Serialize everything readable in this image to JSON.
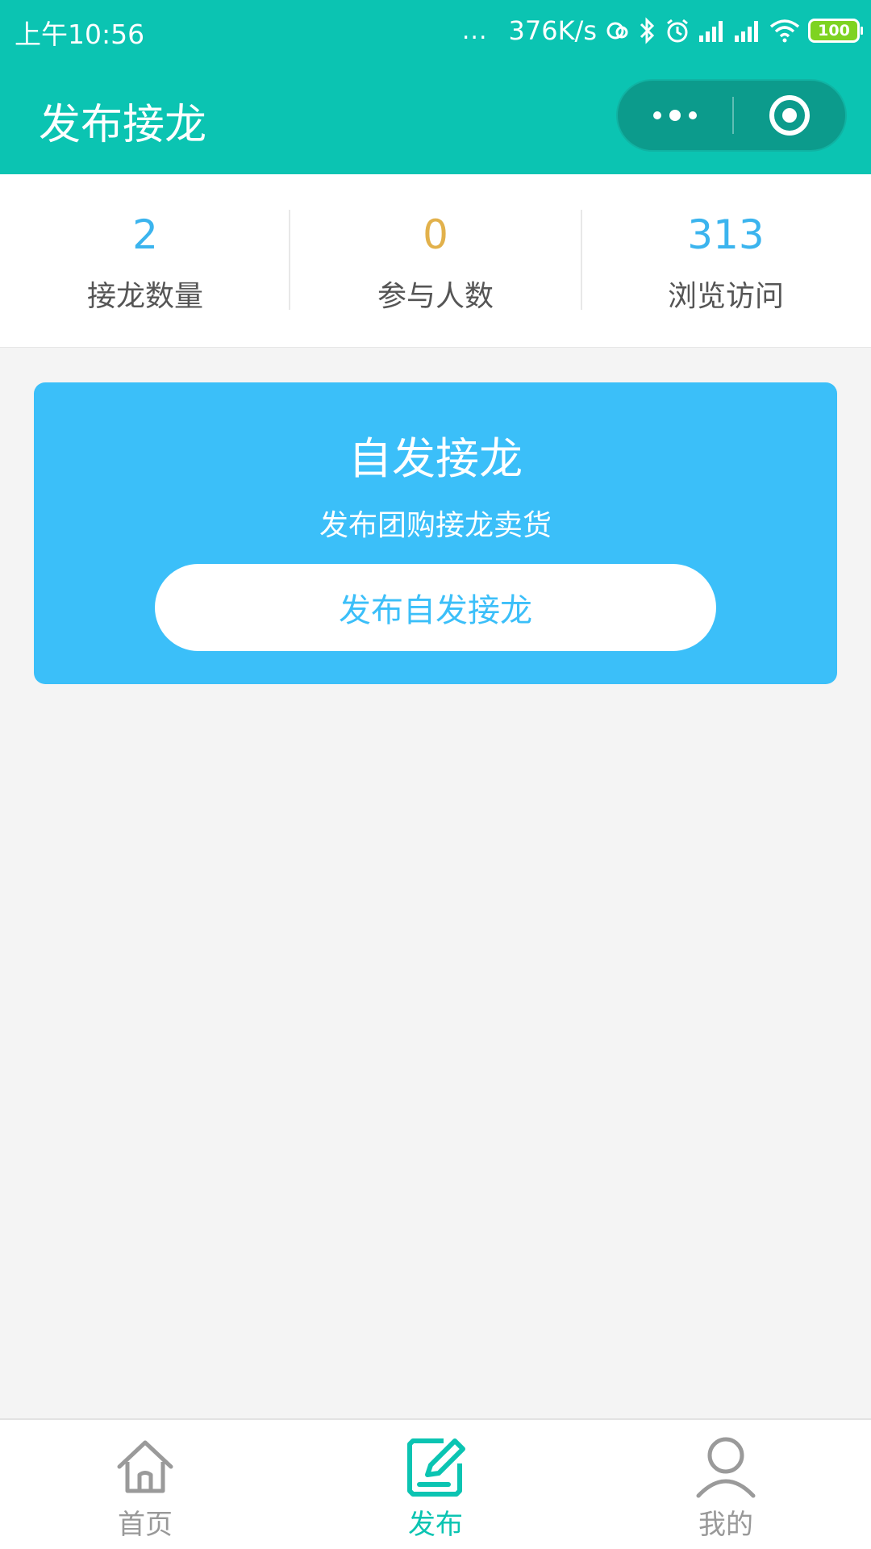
{
  "status_bar": {
    "time": "上午10:56",
    "dots": "...",
    "speed": "376K/s",
    "battery": "100",
    "icons": [
      "sync-icon",
      "bluetooth-icon",
      "alarm-icon",
      "signal-icon",
      "signal-icon",
      "wifi-icon",
      "battery-icon"
    ]
  },
  "nav": {
    "title": "发布接龙",
    "more_icon": "more-icon",
    "close_icon": "target-icon"
  },
  "stats": [
    {
      "value": "2",
      "label": "接龙数量",
      "color": "#3bb4ee"
    },
    {
      "value": "0",
      "label": "参与人数",
      "color": "#e2b14b"
    },
    {
      "value": "313",
      "label": "浏览访问",
      "color": "#3bb4ee"
    }
  ],
  "card": {
    "title": "自发接龙",
    "subtitle": "发布团购接龙卖货",
    "button_label": "发布自发接龙"
  },
  "tabbar": {
    "items": [
      {
        "label": "首页",
        "icon": "home-icon",
        "active": false
      },
      {
        "label": "发布",
        "icon": "edit-icon",
        "active": true
      },
      {
        "label": "我的",
        "icon": "user-icon",
        "active": false
      }
    ],
    "active_color": "#0bc4b2",
    "inactive_color": "#999999"
  },
  "colors": {
    "primary": "#0bc4b2",
    "card": "#3bbff9",
    "background": "#f4f4f4"
  }
}
